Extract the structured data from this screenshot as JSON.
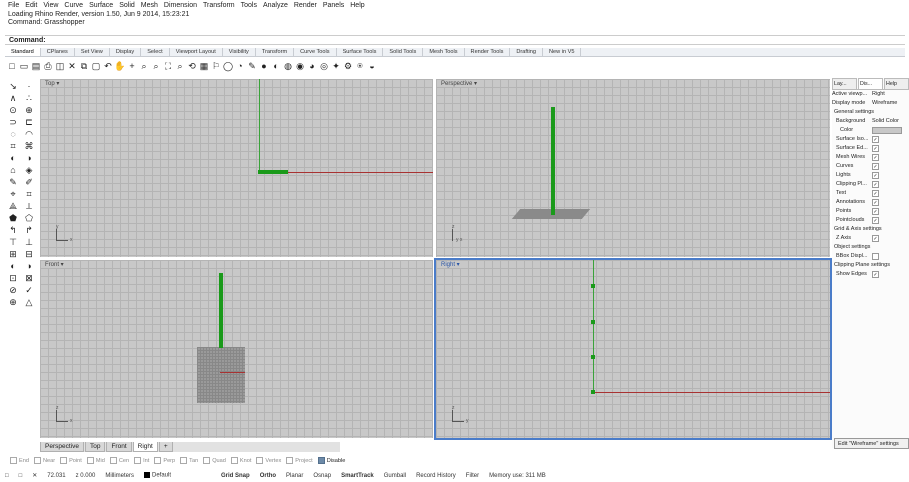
{
  "menu": [
    "File",
    "Edit",
    "View",
    "Curve",
    "Surface",
    "Solid",
    "Mesh",
    "Dimension",
    "Transform",
    "Tools",
    "Analyze",
    "Render",
    "Panels",
    "Help"
  ],
  "command_history": [
    "Loading Rhino Render, version 1.50, Jun  9 2014, 15:23:21",
    "Command: Grasshopper"
  ],
  "command_prompt": "Command:",
  "toolbar_tabs": [
    "Standard",
    "CPlanes",
    "Set View",
    "Display",
    "Select",
    "Viewport Layout",
    "Visibility",
    "Transform",
    "Curve Tools",
    "Surface Tools",
    "Solid Tools",
    "Mesh Tools",
    "Render Tools",
    "Drafting",
    "New in V5"
  ],
  "toolbar_icons": [
    "□",
    "▭",
    "▤",
    "⎙",
    "◫",
    "✕",
    "⧉",
    "▢",
    "↶",
    "✋",
    "+",
    "⌕",
    "⌕",
    "⛶",
    "⌕",
    "⟲",
    "▦",
    "⚐",
    "◯",
    "◔",
    "✎",
    "●",
    "◐",
    "◍",
    "◉",
    "◕",
    "◎",
    "✦",
    "⚙",
    "⍟",
    "◒"
  ],
  "left_tools": [
    "↘",
    "·",
    "∧",
    "∴",
    "⊙",
    "⊕",
    "⊃",
    "⊏",
    "◌",
    "◠",
    "⌗",
    "⌘",
    "◐",
    "◑",
    "⌂",
    "◈",
    "✎",
    "✐",
    "⌖",
    "⌗",
    "⟁",
    "⟂",
    "⬟",
    "⬠",
    "↰",
    "↱",
    "⊤",
    "⊥",
    "⊞",
    "⊟",
    "◐",
    "◑",
    "⊡",
    "⊠",
    "⊘",
    "✓",
    "⊕",
    "△"
  ],
  "viewports": {
    "top": {
      "title": "Top ▾",
      "axis_y_label": "y",
      "axis_x_label": "x"
    },
    "perspective": {
      "title": "Perspective ▾",
      "axis_z_label": "z",
      "axis_xy_label": "y  x"
    },
    "front": {
      "title": "Front ▾",
      "axis_z_label": "z",
      "axis_x_label": "x"
    },
    "right": {
      "title": "Right ▾",
      "axis_z_label": "z",
      "axis_y_label": "y"
    }
  },
  "view_tabs": [
    "Perspective",
    "Top",
    "Front",
    "Right",
    "+"
  ],
  "active_view_tab": "Right",
  "osnaps": [
    {
      "label": "End",
      "checked": false
    },
    {
      "label": "Near",
      "checked": false
    },
    {
      "label": "Point",
      "checked": false
    },
    {
      "label": "Mid",
      "checked": false
    },
    {
      "label": "Cen",
      "checked": false
    },
    {
      "label": "Int",
      "checked": false
    },
    {
      "label": "Perp",
      "checked": false
    },
    {
      "label": "Tan",
      "checked": false
    },
    {
      "label": "Quad",
      "checked": false
    },
    {
      "label": "Knot",
      "checked": false
    },
    {
      "label": "Vertex",
      "checked": false
    },
    {
      "label": "Project",
      "checked": false
    },
    {
      "label": "Disable",
      "checked": true
    }
  ],
  "status": {
    "plane_icons": [
      "□",
      "□",
      "✕"
    ],
    "coord_x": "72.031",
    "coord_z": "z 0.000",
    "units": "Millimeters",
    "layer": "Default",
    "items": [
      "Grid Snap",
      "Ortho",
      "Planar",
      "Osnap",
      "SmartTrack",
      "Gumball",
      "Record History",
      "Filter",
      "Memory use: 311 MB"
    ],
    "bold_items": [
      "Grid Snap",
      "Ortho",
      "SmartTrack"
    ]
  },
  "right_panel": {
    "tabs": [
      "Lay...",
      "Dis...",
      "Help"
    ],
    "active_viewport_label": "Active viewp...",
    "active_viewport_value": "Right",
    "display_mode_label": "Display mode",
    "display_mode_value": "Wireframe",
    "general_settings": "General settings",
    "background_label": "Background",
    "background_value": "Solid Color",
    "color_label": "Color",
    "rows": [
      "Surface Iso...",
      "Surface Ed...",
      "Mesh Wires",
      "Curves",
      "Lights",
      "Clipping Pl...",
      "Text",
      "Annotations",
      "Points",
      "Pointclouds"
    ],
    "grid_axis_settings": "Grid & Axis settings",
    "z_axis_label": "Z Axis",
    "object_settings": "Object settings",
    "bbox_label": "BBox Displ...",
    "clipping_plane_settings": "Clipping Plane settings",
    "show_edges_label": "Show Edges",
    "edit_button": "Edit \"Wireframe\" settings"
  },
  "colors": {
    "viewport_bg": "#c8c8c8",
    "grid_line": "#b4b4b4",
    "x_axis": "#a83232",
    "y_axis": "#3aa33a",
    "geometry": "#1a9a1a",
    "active_outline": "#4a7cc9"
  }
}
